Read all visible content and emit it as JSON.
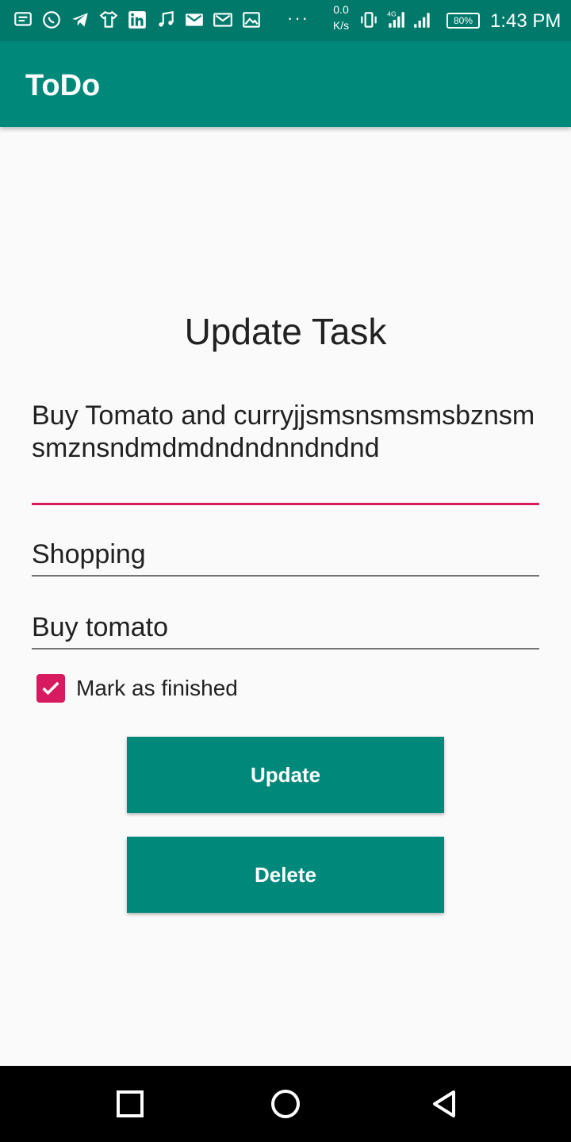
{
  "status_bar": {
    "net_speed_value": "0.0",
    "net_speed_unit": "K/s",
    "battery": "80%",
    "time": "1:43 PM",
    "more": "···"
  },
  "app_bar": {
    "title": "ToDo",
    "color": "#00897b"
  },
  "form": {
    "heading": "Update Task",
    "description_value": "Buy Tomato and curryjjsmsnsmsmsbznsmsmznsndmdmdndndnndndnd",
    "category_value": "Shopping",
    "title_value": "Buy tomato",
    "finished_label": "Mark as finished",
    "finished_checked": true,
    "update_label": "Update",
    "delete_label": "Delete"
  },
  "colors": {
    "primary": "#00897b",
    "accent": "#d81b60"
  },
  "icons": {
    "status_left": [
      "message-icon",
      "whatsapp-icon",
      "telegram-icon",
      "tshirt-icon",
      "linkedin-icon",
      "music-icon",
      "gmail-icon",
      "gmail-icon",
      "image-icon"
    ],
    "status_right": [
      "vibrate-icon",
      "signal-4g-icon",
      "signal-icon",
      "battery-icon"
    ],
    "nav": [
      "recent-apps-icon",
      "home-icon",
      "back-icon"
    ]
  }
}
